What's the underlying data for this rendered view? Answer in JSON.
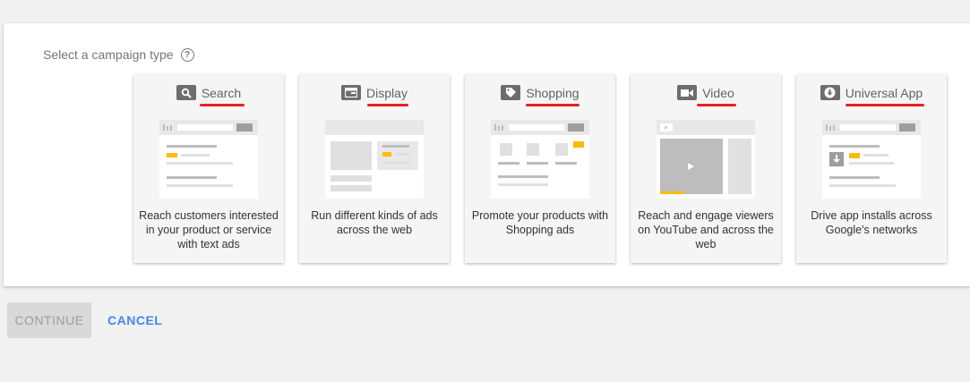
{
  "heading": {
    "label": "Select a campaign type",
    "help_icon": "?"
  },
  "cards": [
    {
      "title": "Search",
      "icon": "search-icon",
      "description": "Reach customers interested in your product or service with text ads"
    },
    {
      "title": "Display",
      "icon": "display-icon",
      "description": "Run different kinds of ads across the web"
    },
    {
      "title": "Shopping",
      "icon": "tag-icon",
      "description": "Promote your products with Shopping ads"
    },
    {
      "title": "Video",
      "icon": "video-camera-icon",
      "description": "Reach and engage viewers on YouTube and across the web"
    },
    {
      "title": "Universal App",
      "icon": "download-icon",
      "description": "Drive app installs across Google's networks"
    }
  ],
  "actions": {
    "continue_label": "CONTINUE",
    "cancel_label": "CANCEL"
  },
  "colors": {
    "accent": "#4285f4",
    "annotation": "#e8201f",
    "highlight": "#fbbc04"
  }
}
